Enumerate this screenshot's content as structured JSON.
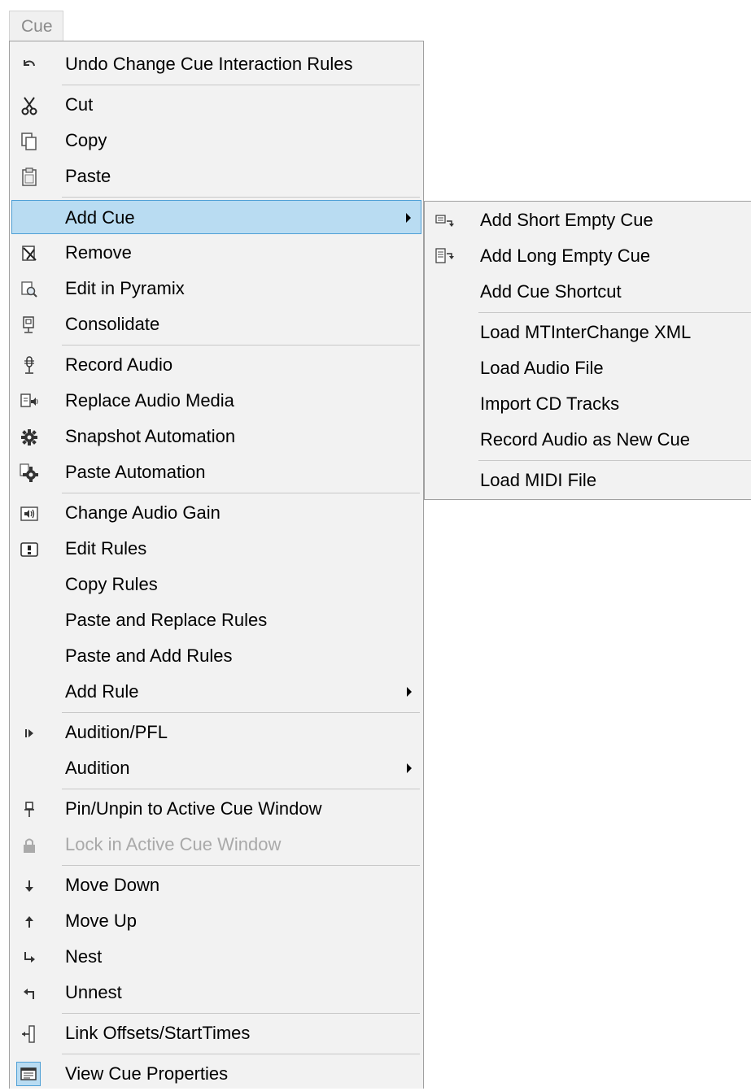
{
  "menubar": {
    "label": "Cue"
  },
  "menu": {
    "items": [
      {
        "label": "Undo Change Cue Interaction Rules",
        "icon": "undo-icon"
      },
      {
        "label": "Cut",
        "icon": "scissors-icon"
      },
      {
        "label": "Copy",
        "icon": "copy-icon"
      },
      {
        "label": "Paste",
        "icon": "paste-icon"
      },
      {
        "label": "Add Cue",
        "icon": "",
        "submenu": true,
        "highlighted": true
      },
      {
        "label": "Remove",
        "icon": "remove-cue-icon"
      },
      {
        "label": "Edit in Pyramix",
        "icon": "edit-magnify-icon"
      },
      {
        "label": "Consolidate",
        "icon": "consolidate-icon"
      },
      {
        "label": "Record Audio",
        "icon": "microphone-icon"
      },
      {
        "label": "Replace Audio Media",
        "icon": "replace-audio-icon"
      },
      {
        "label": "Snapshot Automation",
        "icon": "gear-icon"
      },
      {
        "label": "Paste Automation",
        "icon": "paste-gear-icon"
      },
      {
        "label": "Change Audio Gain",
        "icon": "audio-gain-icon"
      },
      {
        "label": "Edit Rules",
        "icon": "rules-icon"
      },
      {
        "label": "Copy Rules",
        "icon": ""
      },
      {
        "label": "Paste and Replace Rules",
        "icon": ""
      },
      {
        "label": "Paste and Add Rules",
        "icon": ""
      },
      {
        "label": "Add Rule",
        "icon": "",
        "submenu": true
      },
      {
        "label": "Audition/PFL",
        "icon": "play-icon"
      },
      {
        "label": "Audition",
        "icon": "",
        "submenu": true
      },
      {
        "label": "Pin/Unpin to Active Cue Window",
        "icon": "pin-icon"
      },
      {
        "label": "Lock in Active Cue Window",
        "icon": "lock-icon",
        "disabled": true
      },
      {
        "label": "Move Down",
        "icon": "arrow-down-icon"
      },
      {
        "label": "Move Up",
        "icon": "arrow-up-icon"
      },
      {
        "label": "Nest",
        "icon": "nest-icon"
      },
      {
        "label": "Unnest",
        "icon": "unnest-icon"
      },
      {
        "label": "Link Offsets/StartTimes",
        "icon": "link-offsets-icon"
      },
      {
        "label": "View Cue Properties",
        "icon": "properties-icon"
      }
    ]
  },
  "submenu": {
    "items": [
      {
        "label": "Add Short Empty Cue",
        "icon": "short-cue-icon"
      },
      {
        "label": "Add Long Empty Cue",
        "icon": "long-cue-icon"
      },
      {
        "label": "Add Cue Shortcut",
        "icon": ""
      },
      {
        "label": "Load MTInterChange XML",
        "icon": ""
      },
      {
        "label": "Load Audio File",
        "icon": ""
      },
      {
        "label": "Import CD Tracks",
        "icon": ""
      },
      {
        "label": "Record Audio as New Cue",
        "icon": ""
      },
      {
        "label": "Load MIDI File",
        "icon": ""
      }
    ]
  },
  "colors": {
    "menu_bg": "#f2f2f2",
    "highlight_bg": "#b9dcf2",
    "highlight_border": "#4fa0d6",
    "disabled_text": "#a9a9a9"
  }
}
